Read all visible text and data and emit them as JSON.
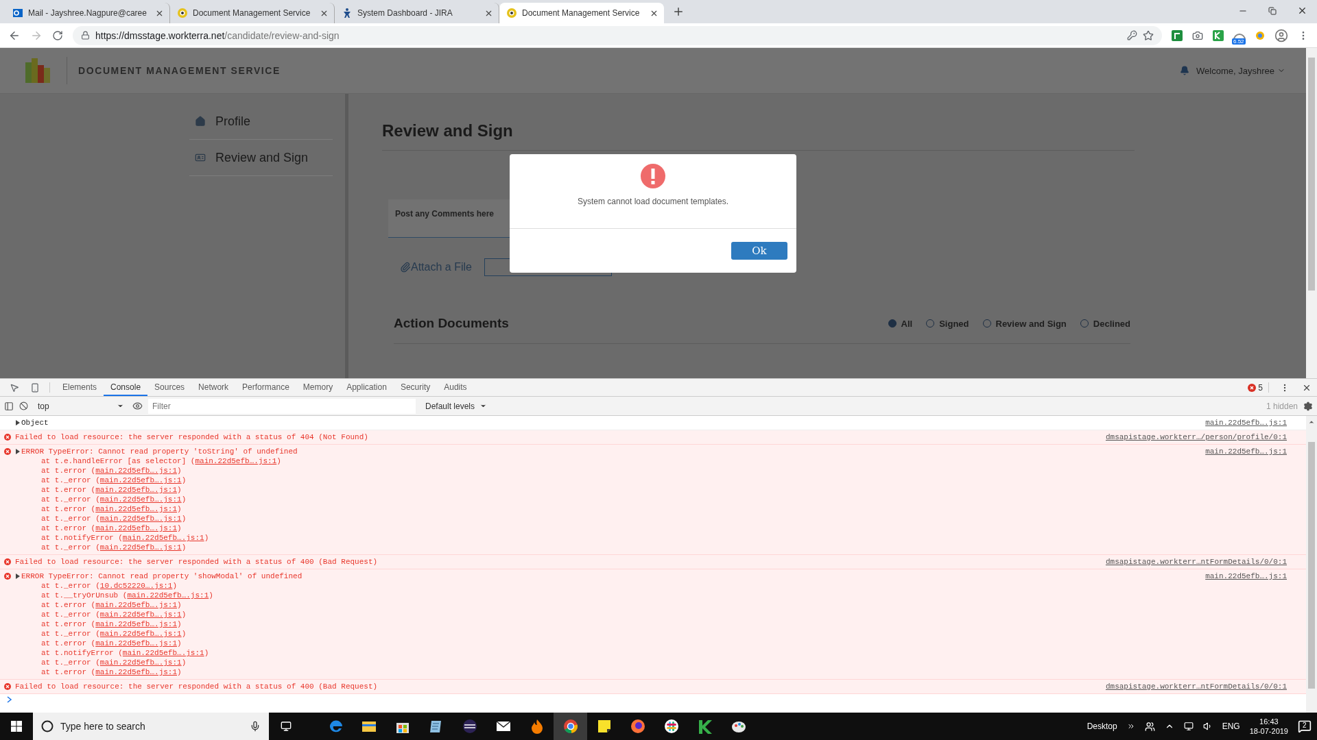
{
  "browser": {
    "tabs": [
      {
        "title": "Mail - Jayshree.Nagpure@caree",
        "kind": "mail",
        "selected": false
      },
      {
        "title": "Document Management Service",
        "kind": "dms",
        "selected": false
      },
      {
        "title": "System Dashboard - JIRA",
        "kind": "jira",
        "selected": false
      },
      {
        "title": "Document Management Service",
        "kind": "dms",
        "selected": true
      }
    ],
    "address": {
      "origin": "https://dmsstage.workterra.net",
      "path": "/candidate/review-and-sign"
    },
    "extension_badge": "6.52"
  },
  "header": {
    "title": "DOCUMENT MANAGEMENT SERVICE",
    "welcome": "Welcome, Jayshree"
  },
  "sidebar": {
    "items": [
      {
        "label": "Profile",
        "kind": "home"
      },
      {
        "label": "Review and Sign",
        "kind": "badge"
      }
    ]
  },
  "main": {
    "heading": "Review and Sign",
    "comment_placeholder": "Post any Comments here",
    "attach_label": "Attach a File",
    "section": "Action Documents",
    "filters": [
      {
        "label": "All",
        "selected": true
      },
      {
        "label": "Signed",
        "selected": false
      },
      {
        "label": "Review and Sign",
        "selected": false
      },
      {
        "label": "Declined",
        "selected": false
      }
    ]
  },
  "dialog": {
    "message": "System cannot load document templates.",
    "button": "Ok"
  },
  "devtools": {
    "tabs": [
      {
        "label": "Elements",
        "selected": false
      },
      {
        "label": "Console",
        "selected": true
      },
      {
        "label": "Sources",
        "selected": false
      },
      {
        "label": "Network",
        "selected": false
      },
      {
        "label": "Performance",
        "selected": false
      },
      {
        "label": "Memory",
        "selected": false
      },
      {
        "label": "Application",
        "selected": false
      },
      {
        "label": "Security",
        "selected": false
      },
      {
        "label": "Audits",
        "selected": false
      }
    ],
    "error_count": "5",
    "context": "top",
    "filter_placeholder": "Filter",
    "levels": "Default levels",
    "hidden": "1 hidden",
    "messages": [
      {
        "kind": "log",
        "expandable": true,
        "text": "Object",
        "source": "main.22d5efb….js:1"
      },
      {
        "kind": "error",
        "expandable": false,
        "text": "Failed to load resource: the server responded with a status of 404 (Not Found)",
        "source": "dmsapistage.workterr…/person/profile/0:1"
      },
      {
        "kind": "error",
        "expandable": true,
        "text": "ERROR TypeError: Cannot read property 'toString' of undefined",
        "source": "main.22d5efb….js:1",
        "frames": [
          {
            "call": "at t.e.handleError [as selector] (",
            "link": "main.22d5efb….js:1",
            "end": ")"
          },
          {
            "call": "at t.error (",
            "link": "main.22d5efb….js:1",
            "end": ")"
          },
          {
            "call": "at t._error (",
            "link": "main.22d5efb….js:1",
            "end": ")"
          },
          {
            "call": "at t.error (",
            "link": "main.22d5efb….js:1",
            "end": ")"
          },
          {
            "call": "at t._error (",
            "link": "main.22d5efb….js:1",
            "end": ")"
          },
          {
            "call": "at t.error (",
            "link": "main.22d5efb….js:1",
            "end": ")"
          },
          {
            "call": "at t._error (",
            "link": "main.22d5efb….js:1",
            "end": ")"
          },
          {
            "call": "at t.error (",
            "link": "main.22d5efb….js:1",
            "end": ")"
          },
          {
            "call": "at t.notifyError (",
            "link": "main.22d5efb….js:1",
            "end": ")"
          },
          {
            "call": "at t._error (",
            "link": "main.22d5efb….js:1",
            "end": ")"
          }
        ]
      },
      {
        "kind": "error",
        "expandable": false,
        "text": "Failed to load resource: the server responded with a status of 400 (Bad Request)",
        "source": "dmsapistage.workterr…ntFormDetails/0/0:1"
      },
      {
        "kind": "error",
        "expandable": true,
        "text": "ERROR TypeError: Cannot read property 'showModal' of undefined",
        "source": "main.22d5efb….js:1",
        "frames": [
          {
            "call": "at t._error (",
            "link": "10.dc52220….js:1",
            "end": ")"
          },
          {
            "call": "at t.__tryOrUnsub (",
            "link": "main.22d5efb….js:1",
            "end": ")"
          },
          {
            "call": "at t.error (",
            "link": "main.22d5efb….js:1",
            "end": ")"
          },
          {
            "call": "at t._error (",
            "link": "main.22d5efb….js:1",
            "end": ")"
          },
          {
            "call": "at t.error (",
            "link": "main.22d5efb….js:1",
            "end": ")"
          },
          {
            "call": "at t._error (",
            "link": "main.22d5efb….js:1",
            "end": ")"
          },
          {
            "call": "at t.error (",
            "link": "main.22d5efb….js:1",
            "end": ")"
          },
          {
            "call": "at t.notifyError (",
            "link": "main.22d5efb….js:1",
            "end": ")"
          },
          {
            "call": "at t._error (",
            "link": "main.22d5efb….js:1",
            "end": ")"
          },
          {
            "call": "at t.error (",
            "link": "main.22d5efb….js:1",
            "end": ")"
          }
        ]
      },
      {
        "kind": "error",
        "expandable": false,
        "text": "Failed to load resource: the server responded with a status of 400 (Bad Request)",
        "source": "dmsapistage.workterr…ntFormDetails/0/0:1"
      }
    ]
  },
  "taskbar": {
    "search_placeholder": "Type here to search",
    "apps": [
      {
        "kind": "edge",
        "active": false
      },
      {
        "kind": "folder",
        "active": false
      },
      {
        "kind": "store",
        "active": false
      },
      {
        "kind": "notepad",
        "active": false
      },
      {
        "kind": "eclipse",
        "active": false
      },
      {
        "kind": "mail",
        "active": false
      },
      {
        "kind": "flame",
        "active": false
      },
      {
        "kind": "chrome",
        "active": true
      },
      {
        "kind": "sticky",
        "active": false
      },
      {
        "kind": "firefox",
        "active": false
      },
      {
        "kind": "slack",
        "active": false
      },
      {
        "kind": "kotlin",
        "active": false
      },
      {
        "kind": "paint",
        "active": false
      }
    ],
    "desktop": "Desktop",
    "language": "ENG",
    "time": "16:43",
    "date": "18-07-2019",
    "notifications": "2"
  }
}
